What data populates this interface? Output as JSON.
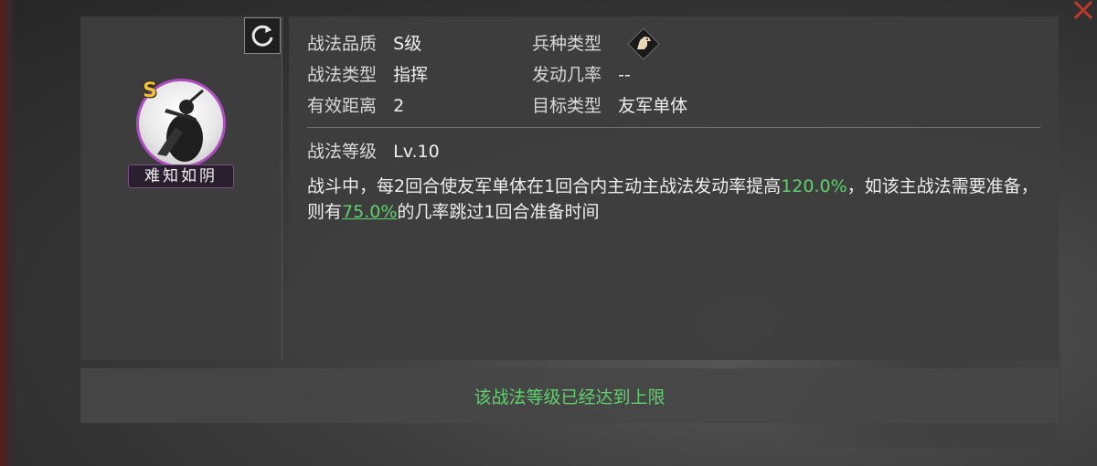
{
  "skill": {
    "name": "难知如阴",
    "grade_badge": "S",
    "quality_label": "战法品质",
    "quality_value": "S级",
    "type_label": "战法类型",
    "type_value": "指挥",
    "range_label": "有效距离",
    "range_value": "2",
    "troop_label": "兵种类型",
    "troop_icon": "horse-icon",
    "rate_label": "发动几率",
    "rate_value": "--",
    "target_label": "目标类型",
    "target_value": "友军单体",
    "level_label": "战法等级",
    "level_value": "Lv.10"
  },
  "description": {
    "p1": "战斗中，每2回合使友军单体在1回合内主动主战法发动率提高",
    "v1": "120.0%",
    "p2": "，如该主战法需要准备，则有",
    "v2": "75.0%",
    "p3": "的几率跳过1回合准备时间"
  },
  "footer": {
    "status": "该战法等级已经达到上限"
  },
  "colors": {
    "highlight": "#5fd16c",
    "grade": "#f0c23b",
    "portrait_ring": "#b04dc0",
    "close": "#c0392b"
  }
}
